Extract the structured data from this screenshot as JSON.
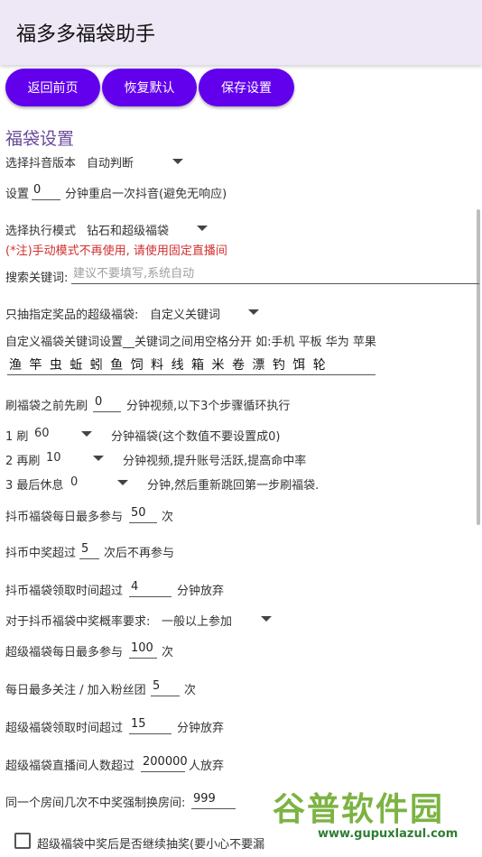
{
  "app": {
    "title": "福多多福袋助手"
  },
  "buttons": {
    "back": "返回前页",
    "reset": "恢复默认",
    "save": "保存设置"
  },
  "section_title": "福袋设置",
  "douyin_version": {
    "label": "选择抖音版本",
    "value": "自动判断"
  },
  "restart": {
    "prefix": "设置",
    "value": "0",
    "suffix": "分钟重启一次抖音(避免无响应)"
  },
  "mode": {
    "label": "选择执行模式",
    "value": "钻石和超级福袋",
    "note": "(*注)手动模式不再使用, 请使用固定直播间"
  },
  "search": {
    "label": "搜索关键词:",
    "placeholder": "建议不要填写,系统自动"
  },
  "prize_filter": {
    "label": "只抽指定奖品的超级福袋:",
    "value": "自定义关键词"
  },
  "custom_keywords": {
    "label": "自定义福袋关键词设置__关键词之间用空格分开 如:手机 平板 华为 苹果",
    "value": "渔 竿 虫 蚯 蚓 鱼 饲 料 线 箱 米 卷 漂 钓 饵 轮"
  },
  "pre_video": {
    "prefix": "刷福袋之前先刷",
    "value": "0",
    "suffix": "分钟视频,以下3个步骤循环执行"
  },
  "step1": {
    "label": "1 刷",
    "value": "60",
    "suffix": "分钟福袋(这个数值不要设置成0)"
  },
  "step2": {
    "label": "2 再刷",
    "value": "10",
    "suffix": "分钟视频,提升账号活跃,提高命中率"
  },
  "step3": {
    "label": "3 最后休息",
    "value": "0",
    "suffix": "分钟,然后重新跳回第一步刷福袋."
  },
  "coin_daily": {
    "prefix": "抖币福袋每日最多参与",
    "value": "50",
    "suffix": "次"
  },
  "coin_win": {
    "prefix": "抖币中奖超过",
    "value": "5",
    "suffix": "次后不再参与"
  },
  "coin_timeout": {
    "prefix": "抖币福袋领取时间超过",
    "value": "4",
    "suffix": "分钟放弃"
  },
  "coin_probability": {
    "label": "对于抖币福袋中奖概率要求:",
    "value": "一般以上参加"
  },
  "super_daily": {
    "prefix": "超级福袋每日最多参与",
    "value": "100",
    "suffix": "次"
  },
  "follow_daily": {
    "prefix": "每日最多关注 / 加入粉丝团",
    "value": "5",
    "suffix": "次"
  },
  "super_timeout": {
    "prefix": "超级福袋领取时间超过",
    "value": "15",
    "suffix": "分钟放弃"
  },
  "room_people": {
    "prefix": "超级福袋直播间人数超过",
    "value": "200000",
    "suffix": "人放弃"
  },
  "same_room": {
    "prefix": "同一个房间几次不中奖强制换房间:",
    "value": "999"
  },
  "continue_checkbox": {
    "label": "超级福袋中奖后是否继续抽奖(要小心不要漏",
    "checked": false
  },
  "watermark": {
    "text": "谷普软件园",
    "url": "www.gupuxlazul.com"
  }
}
